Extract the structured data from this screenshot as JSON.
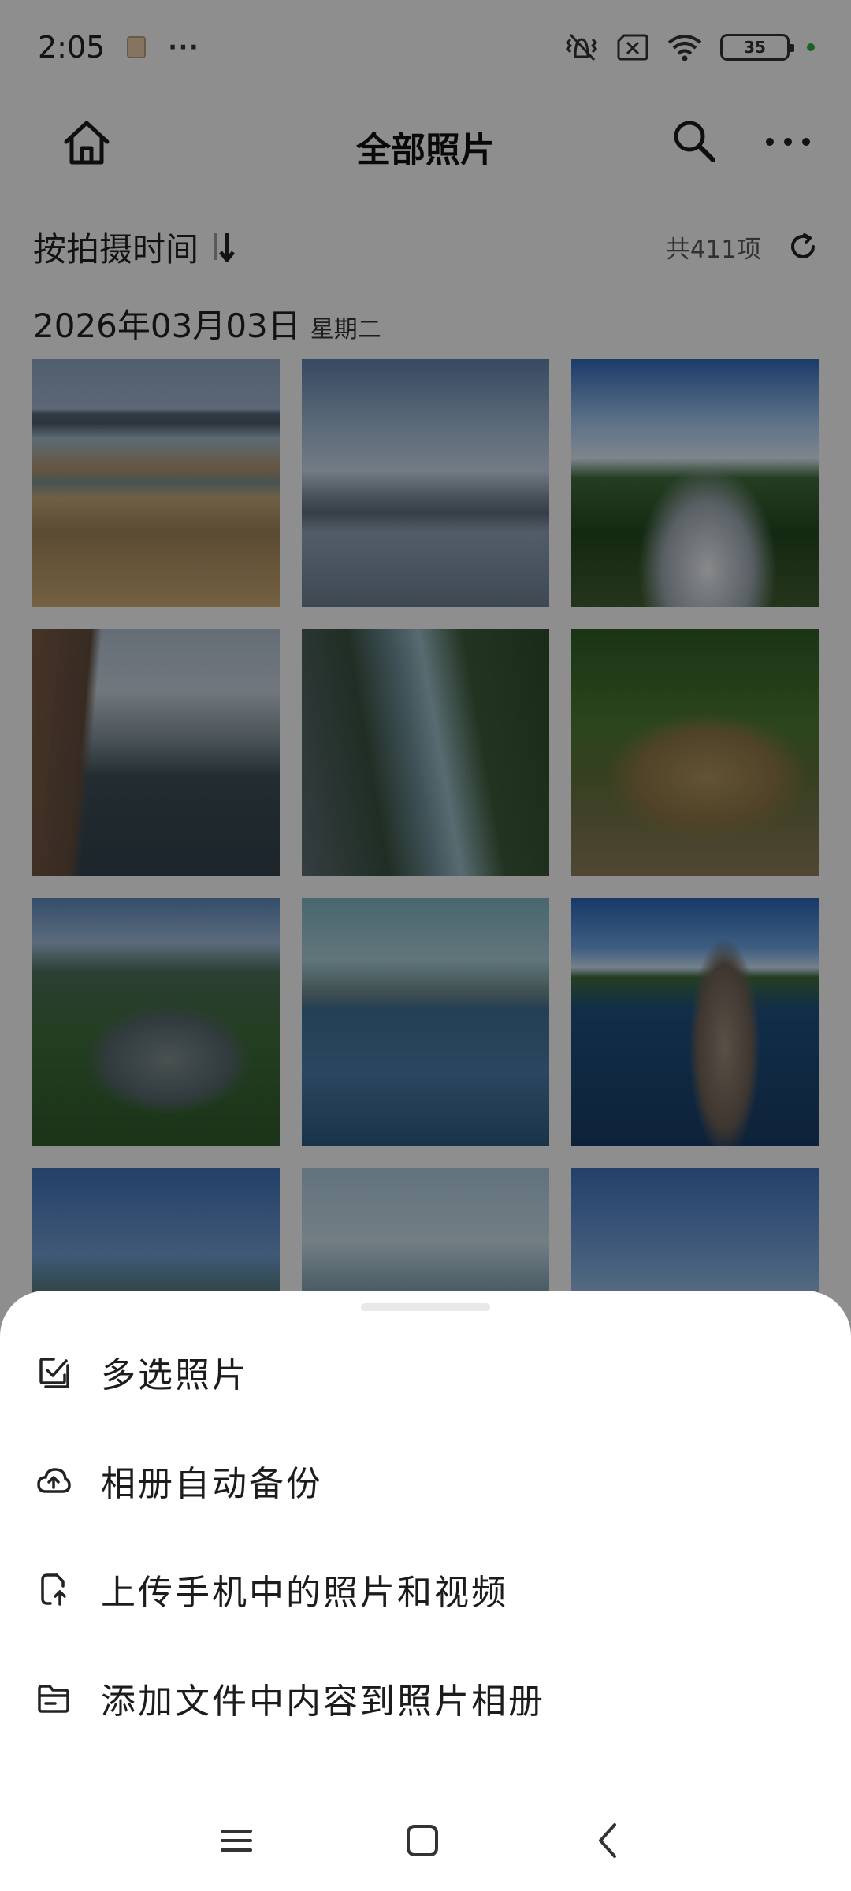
{
  "status_bar": {
    "time": "2:05",
    "more_dots": "···",
    "battery_level": "35"
  },
  "header": {
    "title": "全部照片"
  },
  "sort": {
    "label": "按拍摄时间",
    "count": "共411项"
  },
  "date_group": {
    "date": "2026年03月03日",
    "weekday": "星期二"
  },
  "photos": [
    "river-plateau",
    "lake-clouds",
    "braided-river",
    "gorge-boat",
    "canyon-reflection",
    "muddy-river-forest",
    "river-bend",
    "river-boats",
    "stone-stack",
    "mountain-forest",
    "misty-mountains",
    "sunset-hills"
  ],
  "menu": {
    "items": [
      {
        "label": "多选照片",
        "icon": "multi-select-icon"
      },
      {
        "label": "相册自动备份",
        "icon": "cloud-upload-icon"
      },
      {
        "label": "上传手机中的照片和视频",
        "icon": "phone-upload-icon"
      },
      {
        "label": "添加文件中内容到照片相册",
        "icon": "folder-icon"
      }
    ]
  },
  "colors": {
    "overlay": "rgba(0,0,0,0.42)",
    "sheet_bg": "#ffffff",
    "text_primary": "#1c1c1c",
    "charging": "#2eaa3c"
  }
}
